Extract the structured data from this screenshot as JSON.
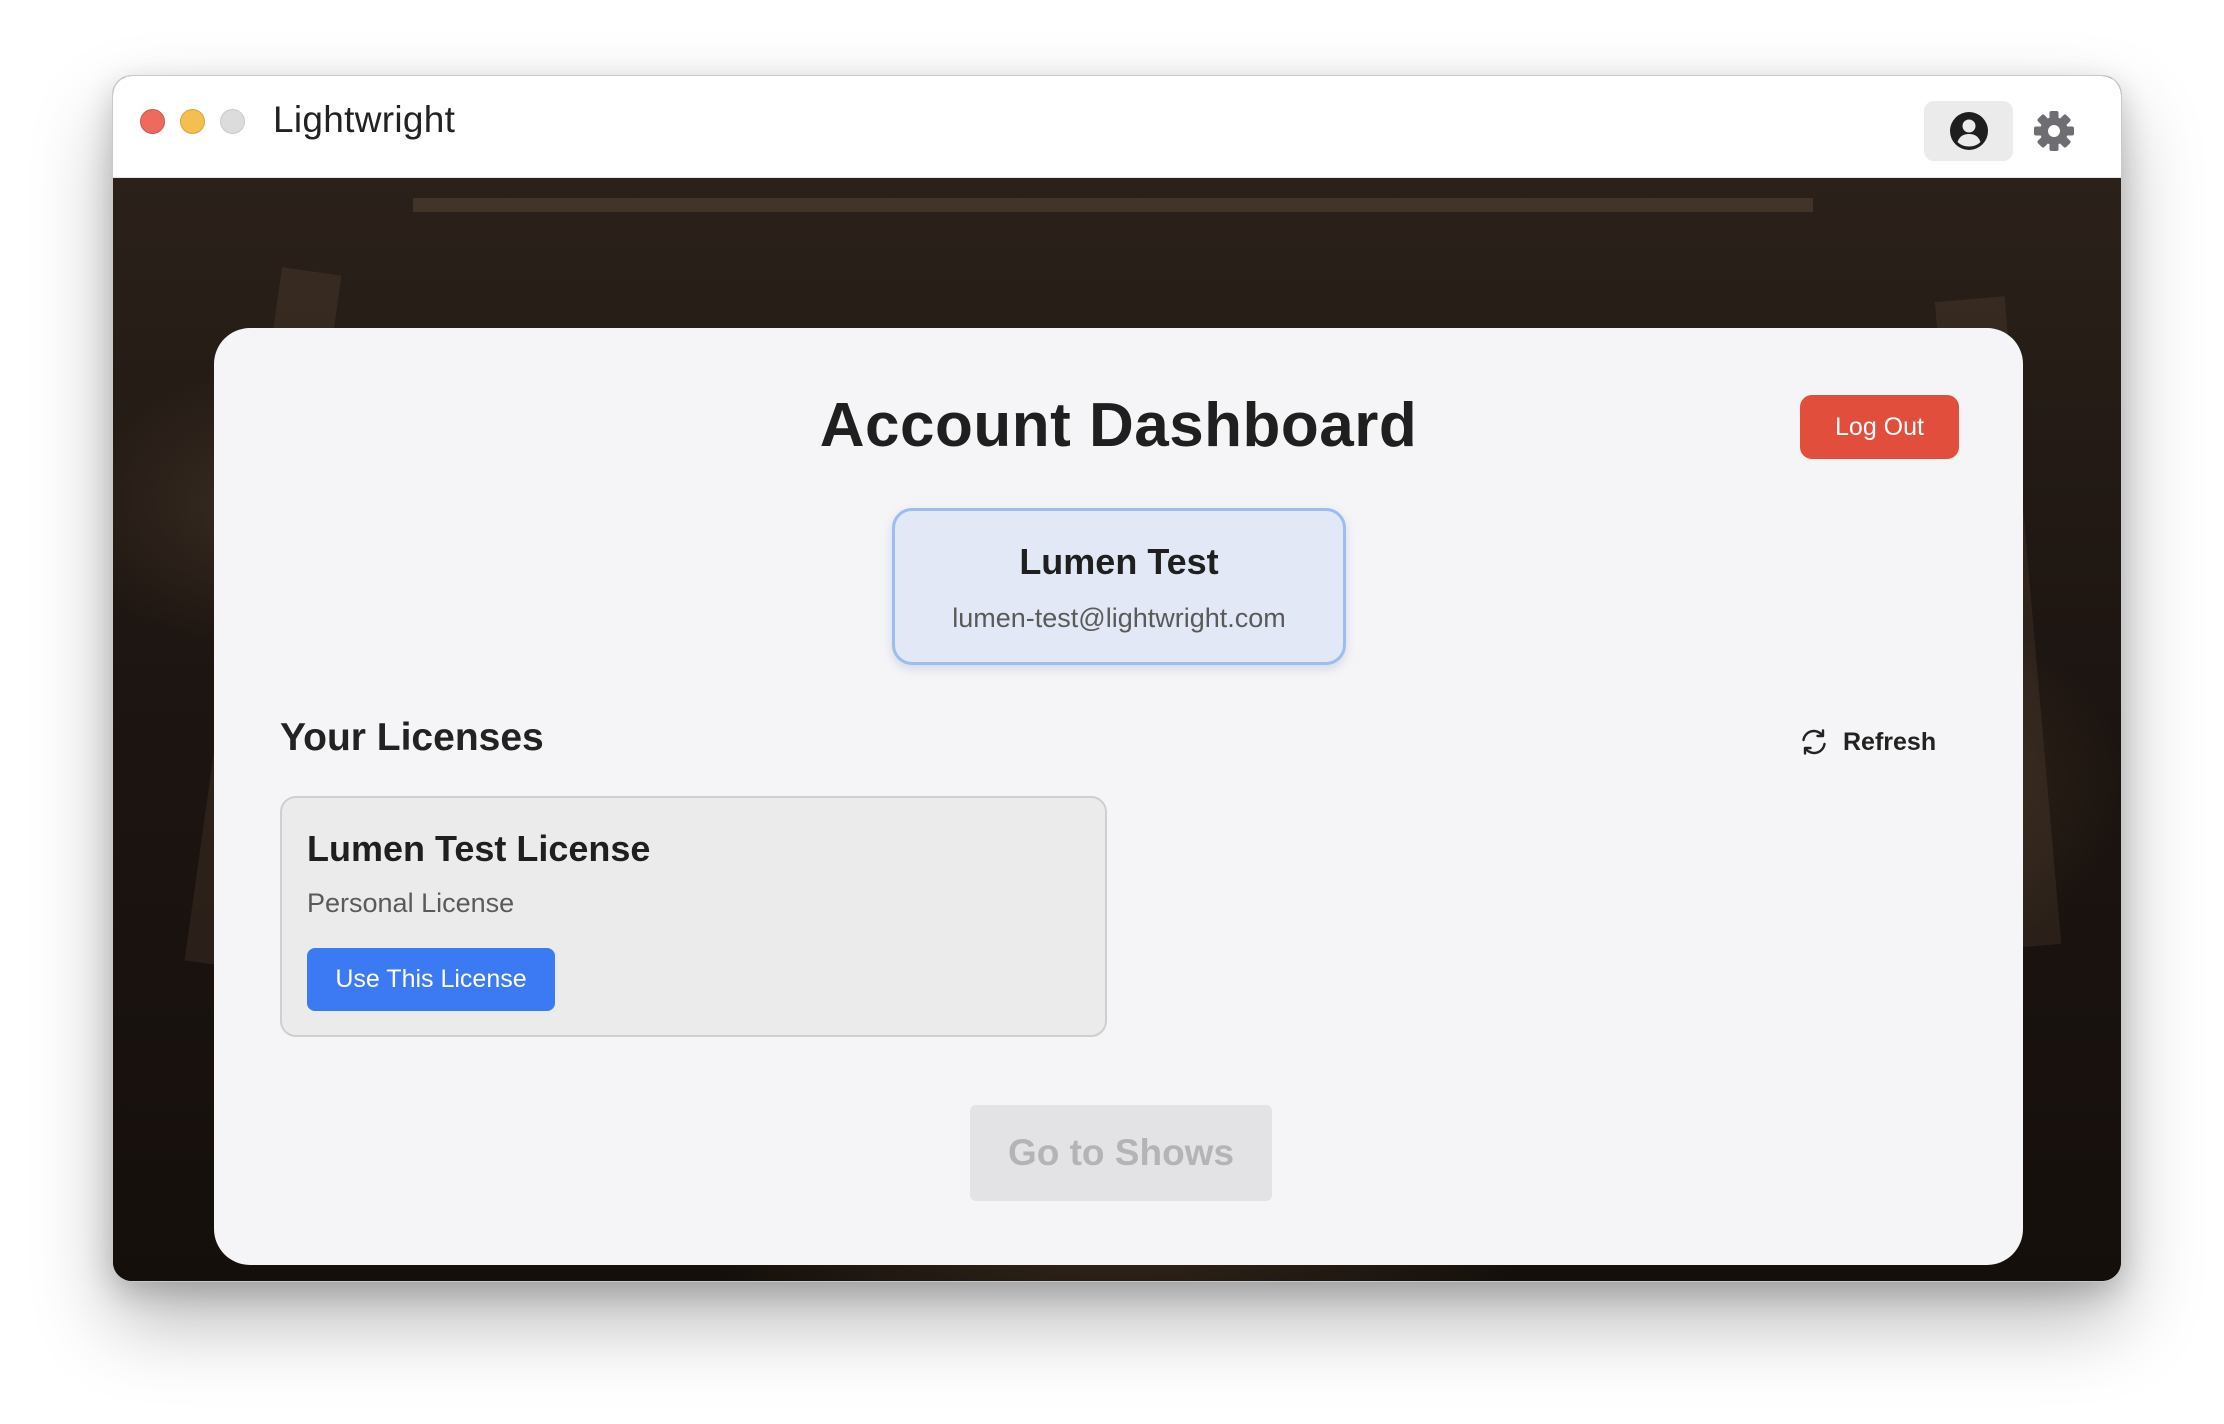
{
  "window": {
    "title": "Lightwright"
  },
  "toolbar": {
    "account_icon": "account-circle-icon",
    "settings_icon": "gear-icon"
  },
  "dashboard": {
    "title": "Account Dashboard",
    "logout_label": "Log Out",
    "user": {
      "name": "Lumen Test",
      "email": "lumen-test@lightwright.com"
    },
    "licenses_heading": "Your Licenses",
    "refresh_label": "Refresh",
    "licenses": [
      {
        "name": "Lumen Test License",
        "type": "Personal License",
        "action_label": "Use This License"
      }
    ],
    "go_to_shows_label": "Go to Shows"
  },
  "colors": {
    "logout": "#e24e3c",
    "primary_button": "#3b7af2",
    "user_box_border": "#9dbcf0",
    "user_box_bg": "#e2e8f6",
    "disabled_button": "#e3e3e5"
  }
}
